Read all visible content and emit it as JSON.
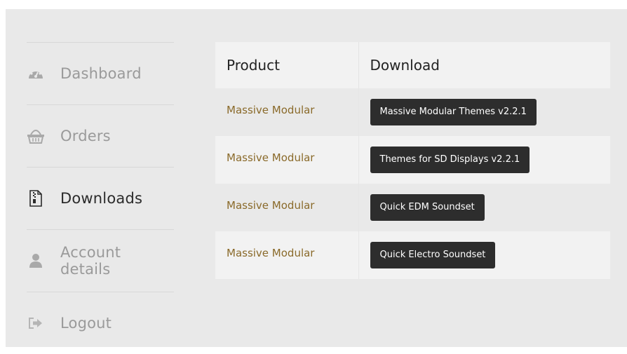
{
  "sidebar": {
    "items": [
      {
        "label": "Dashboard",
        "icon": "dashboard-icon",
        "active": false
      },
      {
        "label": "Orders",
        "icon": "basket-icon",
        "active": false
      },
      {
        "label": "Downloads",
        "icon": "file-download-icon",
        "active": true
      },
      {
        "label": "Account details",
        "icon": "user-icon",
        "active": false
      },
      {
        "label": "Logout",
        "icon": "logout-icon",
        "active": false
      }
    ]
  },
  "table": {
    "headers": {
      "product": "Product",
      "download": "Download"
    },
    "rows": [
      {
        "product": "Massive Modular",
        "download": "Massive Modular Themes v2.2.1"
      },
      {
        "product": "Massive Modular",
        "download": "Themes for SD Displays v2.2.1"
      },
      {
        "product": "Massive Modular",
        "download": "Quick EDM Soundset"
      },
      {
        "product": "Massive Modular",
        "download": "Quick Electro Soundset"
      }
    ]
  },
  "colors": {
    "link": "#8a6a2a",
    "button_bg": "#2d2d2d",
    "panel_bg": "#e9e9e9",
    "muted_text": "#9a9a9a"
  }
}
